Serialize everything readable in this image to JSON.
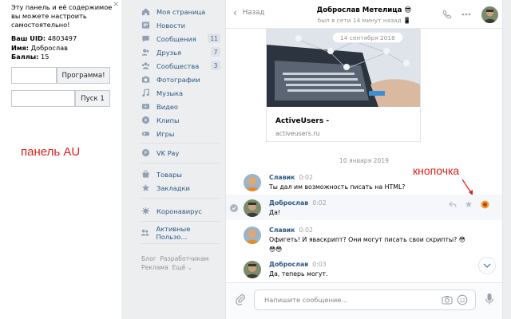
{
  "au_panel": {
    "close": "×",
    "intro": "Эту панель и её содержимое вы можете настроить самостоятельно!",
    "uid_label": "Ваш UID:",
    "uid_value": "4803497",
    "name_label": "Имя:",
    "name_value": "Доброслав",
    "points_label": "Баллы:",
    "points_value": "15",
    "program_input": "",
    "program_button": "Программа!",
    "start_input": "",
    "start_button": "Пуск 1",
    "annotation": "панель AU"
  },
  "menu": {
    "items": [
      {
        "label": "Моя страница",
        "icon": "home-icon"
      },
      {
        "label": "Новости",
        "icon": "news-icon"
      },
      {
        "label": "Сообщения",
        "icon": "message-icon",
        "badge": "11"
      },
      {
        "label": "Друзья",
        "icon": "friends-icon",
        "badge": "7"
      },
      {
        "label": "Сообщества",
        "icon": "groups-icon",
        "badge": "3"
      },
      {
        "label": "Фотографии",
        "icon": "camera-icon"
      },
      {
        "label": "Музыка",
        "icon": "music-icon"
      },
      {
        "label": "Видео",
        "icon": "video-icon"
      },
      {
        "label": "Клипы",
        "icon": "clips-icon"
      },
      {
        "label": "Игры",
        "icon": "games-icon"
      },
      {
        "label": "VK Pay",
        "icon": "vkpay-icon"
      },
      {
        "label": "Товары",
        "icon": "goods-icon"
      },
      {
        "label": "Закладки",
        "icon": "star-icon"
      },
      {
        "label": "Коронавирус",
        "icon": "virus-icon"
      },
      {
        "label": "Активные Пользо...",
        "icon": "users-icon"
      }
    ],
    "footer": {
      "blog": "Блог",
      "developers": "Разработчикам",
      "ads": "Реклама",
      "more": "Ещё ⌄"
    }
  },
  "chat": {
    "back": "Назад",
    "title": "Доброслав Метелица 😎",
    "status": "был в сети 14 минут назад 📱",
    "link_card": {
      "date": "14 сентября 2018",
      "title": "ActiveUsers -",
      "url": "activeusers.ru"
    },
    "date_separator": "10 января 2019",
    "messages": [
      {
        "author": "Славик",
        "time": "0:02",
        "text": "Ты дал им возможность писать на HTML?"
      },
      {
        "author": "Доброслав",
        "time": "0:02",
        "text": "Да!"
      },
      {
        "author": "Славик",
        "time": "0:02",
        "text": "Офигеть! И яваскрипт? Они могут писать свои скрипты? 😳",
        "text2": "😳😳"
      },
      {
        "author": "Доброслав",
        "time": "0:03",
        "text": "Да, теперь могут."
      }
    ],
    "button_annotation": "кнопочка",
    "composer_placeholder": "Напишите сообщение..."
  },
  "colors": {
    "accent": "#2a5885",
    "annotation": "#e0201a",
    "badge_bg": "#dee3e9"
  }
}
